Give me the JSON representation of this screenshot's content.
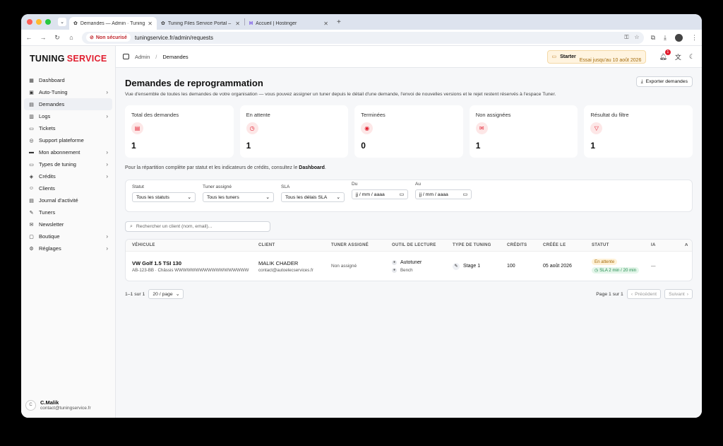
{
  "browser": {
    "tabs": [
      {
        "label": "Demandes — Admin · Tuning",
        "active": true
      },
      {
        "label": "Tuning Files Service Portal –",
        "active": false
      },
      {
        "label": "Accueil | Hostinger",
        "active": false
      }
    ],
    "insecure_label": "Non sécurisé",
    "url": "tuningservice.fr/admin/requests"
  },
  "sidebar": {
    "logo_main": "TUNING",
    "logo_accent": "SERVICE",
    "items": [
      {
        "label": "Dashboard",
        "icon": "dashboard-icon",
        "chevron": false
      },
      {
        "label": "Auto-Tuning",
        "icon": "auto-tuning-icon",
        "chevron": true
      },
      {
        "label": "Demandes",
        "icon": "requests-icon",
        "chevron": false,
        "active": true
      },
      {
        "label": "Logs",
        "icon": "logs-icon",
        "chevron": true
      },
      {
        "label": "Tickets",
        "icon": "tickets-icon",
        "chevron": false
      },
      {
        "label": "Support plateforme",
        "icon": "support-icon",
        "chevron": false
      },
      {
        "label": "Mon abonnement",
        "icon": "subscription-icon",
        "chevron": true
      },
      {
        "label": "Types de tuning",
        "icon": "tuning-types-icon",
        "chevron": true
      },
      {
        "label": "Crédits",
        "icon": "credits-icon",
        "chevron": true
      },
      {
        "label": "Clients",
        "icon": "clients-icon",
        "chevron": false
      },
      {
        "label": "Journal d'activité",
        "icon": "activity-log-icon",
        "chevron": false
      },
      {
        "label": "Tuners",
        "icon": "tuners-icon",
        "chevron": false
      },
      {
        "label": "Newsletter",
        "icon": "newsletter-icon",
        "chevron": false
      },
      {
        "label": "Boutique",
        "icon": "shop-icon",
        "chevron": true
      },
      {
        "label": "Réglages",
        "icon": "settings-icon",
        "chevron": true
      }
    ],
    "user": {
      "initial": "C",
      "name": "C.Malik",
      "email": "contact@tuningservice.fr"
    }
  },
  "topbar": {
    "crumb_root": "Admin",
    "crumb_sep": "/",
    "crumb_current": "Demandes",
    "plan": "Starter",
    "plan_note": "Essai jusqu'au 10 août 2026",
    "notif_count": "1"
  },
  "page": {
    "title": "Demandes de reprogrammation",
    "subtitle": "Vue d'ensemble de toutes les demandes de votre organisation — vous pouvez assigner un tuner depuis le détail d'une demande, l'envoi de nouvelles versions et le rejet restent réservés à l'espace Tuner.",
    "export_label": "Exporter demandes",
    "stats": [
      {
        "label": "Total des demandes",
        "value": "1",
        "icon": "clipboard-icon",
        "glyph": "▤"
      },
      {
        "label": "En attente",
        "value": "1",
        "icon": "clock-icon",
        "glyph": "◷"
      },
      {
        "label": "Terminées",
        "value": "0",
        "icon": "check-icon",
        "glyph": "◉"
      },
      {
        "label": "Non assignées",
        "value": "1",
        "icon": "inbox-icon",
        "glyph": "✉"
      },
      {
        "label": "Résultat du filtre",
        "value": "1",
        "icon": "filter-icon",
        "glyph": "▽"
      }
    ],
    "note_prefix": "Pour la répartition complète par statut et les indicateurs de crédits, consultez le ",
    "note_link": "Dashboard",
    "note_suffix": "."
  },
  "filters": {
    "statut": {
      "label": "Statut",
      "value": "Tous les statuts"
    },
    "tuner": {
      "label": "Tuner assigné",
      "value": "Tous les tuners"
    },
    "sla": {
      "label": "SLA",
      "value": "Tous les délais SLA"
    },
    "du": {
      "label": "Du",
      "value": "jj / mm / aaaa"
    },
    "au": {
      "label": "Au",
      "value": "jj / mm / aaaa"
    }
  },
  "search": {
    "placeholder": "Rechercher un client (nom, email)..."
  },
  "table": {
    "headers": [
      "VÉHICULE",
      "CLIENT",
      "TUNER ASSIGNÉ",
      "OUTIL DE LECTURE",
      "TYPE DE TUNING",
      "CRÉDITS",
      "CRÉÉE LE",
      "STATUT",
      "IA",
      "A"
    ],
    "row": {
      "vehicle": "VW Golf 1.5 TSI 130",
      "vehicle_sub": "AB-123-BB · Châssis WWWWWWWWWWWWWWWWWW",
      "client": "MALIK CHADER",
      "client_email": "contact@autoelecservices.fr",
      "tuner": "Non assigné",
      "tool": "Autotuner",
      "tool_sub": "Bench",
      "tuning_type": "Stage 1",
      "credits": "100",
      "created": "05 août 2026",
      "status": "En attente",
      "sla": "SLA 2 min / 20 min",
      "ia": "—"
    }
  },
  "pager": {
    "range": "1–1 sur 1",
    "pagesize": "20 / page",
    "page": "Page 1 sur 1",
    "prev": "Précédent",
    "next": "Suivant"
  }
}
